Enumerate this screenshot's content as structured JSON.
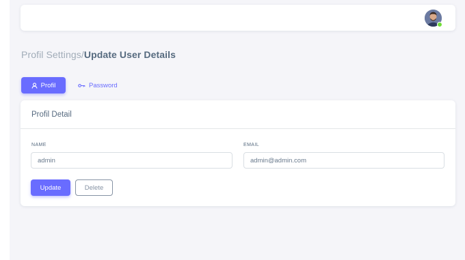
{
  "navbar": {
    "avatar_alt": "user-avatar",
    "status": "online"
  },
  "breadcrumb": {
    "parent": "Profil Settings/",
    "current": "Update User Details"
  },
  "tabs": [
    {
      "label": "Profil",
      "icon": "user-icon",
      "active": true
    },
    {
      "label": "Password",
      "icon": "key-icon",
      "active": false
    }
  ],
  "card": {
    "title": "Profil Detail",
    "fields": {
      "name": {
        "label": "NAME",
        "value": "admin"
      },
      "email": {
        "label": "EMAIL",
        "value": "admin@admin.com"
      }
    },
    "buttons": {
      "update": "Update",
      "delete": "Delete"
    }
  },
  "colors": {
    "primary": "#696cff",
    "background": "#f5f5f9",
    "online": "#71dd37"
  }
}
